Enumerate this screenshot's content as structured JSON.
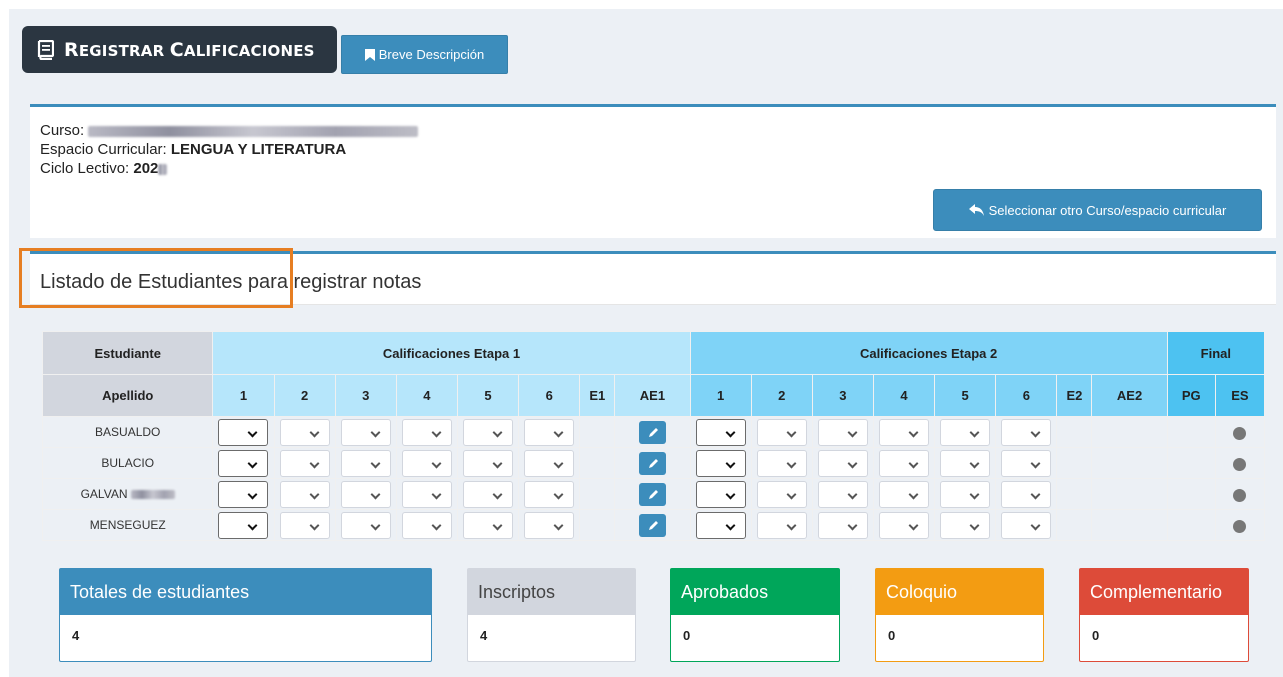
{
  "header": {
    "title_first_big": "R",
    "title_first_rest": "EGISTRAR ",
    "title_second_big": "C",
    "title_second_rest": "ALIFICACIONES",
    "description_button": "Breve Descripción"
  },
  "info": {
    "curso_label": "Curso:",
    "espacio_label": "Espacio Curricular:",
    "espacio_value": "LENGUA Y LITERATURA",
    "ciclo_label": "Ciclo Lectivo:",
    "ciclo_value": "202",
    "select_other_button": "Seleccionar otro Curso/espacio curricular"
  },
  "listado": {
    "title": "Listado de Estudiantes para registrar notas"
  },
  "table": {
    "group_headers": {
      "student": "Estudiante",
      "stage1": "Calificaciones Etapa 1",
      "stage2": "Calificaciones Etapa 2",
      "final": "Final"
    },
    "sub_headers": {
      "surname": "Apellido",
      "s1": [
        "1",
        "2",
        "3",
        "4",
        "5",
        "6",
        "E1",
        "AE1"
      ],
      "s2": [
        "1",
        "2",
        "3",
        "4",
        "5",
        "6",
        "E2",
        "AE2"
      ],
      "final": [
        "PG",
        "ES"
      ]
    },
    "students": [
      "BASUALDO",
      "BULACIO",
      "GALVAN",
      "MENSEGUEZ"
    ]
  },
  "stats": [
    {
      "label": "Totales de estudiantes",
      "value": "4",
      "color": "#3c8dbc",
      "text_color": "#ffffff"
    },
    {
      "label": "Inscriptos",
      "value": "4",
      "color": "#d2d6de",
      "text_color": "#444444"
    },
    {
      "label": "Aprobados",
      "value": "0",
      "color": "#00a65a",
      "text_color": "#ffffff"
    },
    {
      "label": "Coloquio",
      "value": "0",
      "color": "#f39c12",
      "text_color": "#ffffff"
    },
    {
      "label": "Complementario",
      "value": "0",
      "color": "#dd4b39",
      "text_color": "#ffffff"
    }
  ],
  "colors": {
    "primary": "#3c8dbc",
    "dark_badge": "#2b3641",
    "highlight": "#e67e22"
  }
}
